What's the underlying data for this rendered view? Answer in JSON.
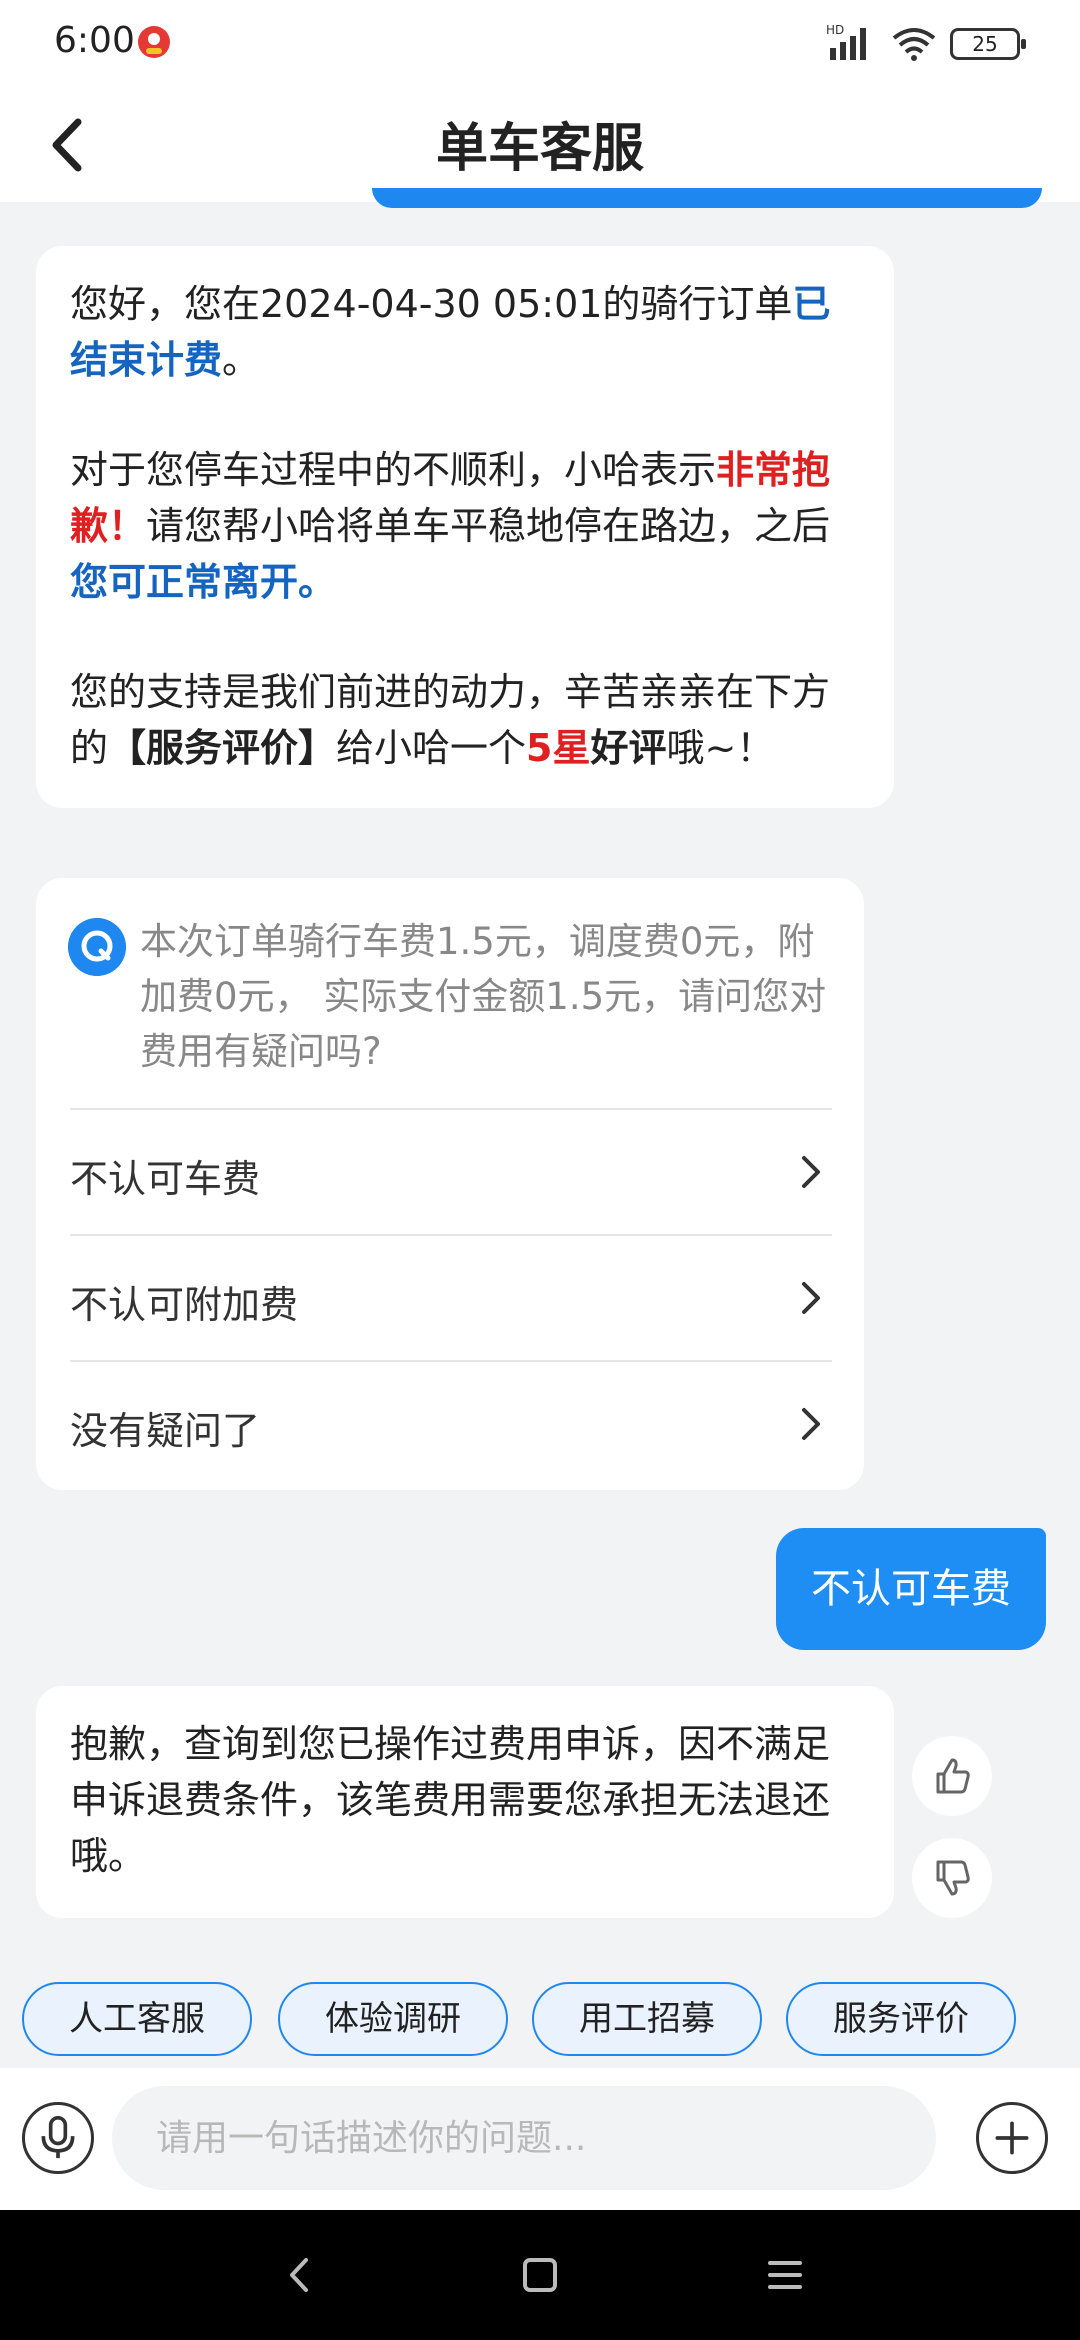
{
  "status_bar": {
    "time": "6:00",
    "battery": "25",
    "network": "HD"
  },
  "header": {
    "title": "单车客服"
  },
  "messages": {
    "msg1": {
      "p1_a": "您好，您在2024-04-30 05:01的骑行订单",
      "p1_b": "已结束计费",
      "p1_c": "。",
      "p2_a": "对于您停车过程中的不顺利，小哈表示",
      "p2_b": "非常抱歉！",
      "p2_c": "请您帮小哈将单车平稳地停在路边，之后",
      "p2_d": "您可正常离开。",
      "p3_a": "您的支持是我们前进的动力，辛苦亲亲在下方的",
      "p3_b": "【服务评价】",
      "p3_c": "给小哈一个",
      "p3_d": "5星",
      "p3_e": "好评",
      "p3_f": "哦~！"
    },
    "msg2": {
      "question": "本次订单骑行车费1.5元，调度费0元，附加费0元， 实际支付金额1.5元，请问您对费用有疑问吗?",
      "options": [
        "不认可车费",
        "不认可附加费",
        "没有疑问了"
      ]
    },
    "user_msg": "不认可车费",
    "msg3": "抱歉，查询到您已操作过费用申诉，因不满足申诉退费条件，该笔费用需要您承担无法退还哦。"
  },
  "quick_actions": [
    "人工客服",
    "体验调研",
    "用工招募",
    "服务评价"
  ],
  "input": {
    "placeholder": "请用一句话描述你的问题..."
  },
  "colors": {
    "accent": "#1e88f0",
    "highlight_blue": "#1565c0",
    "highlight_red": "#e02020"
  }
}
